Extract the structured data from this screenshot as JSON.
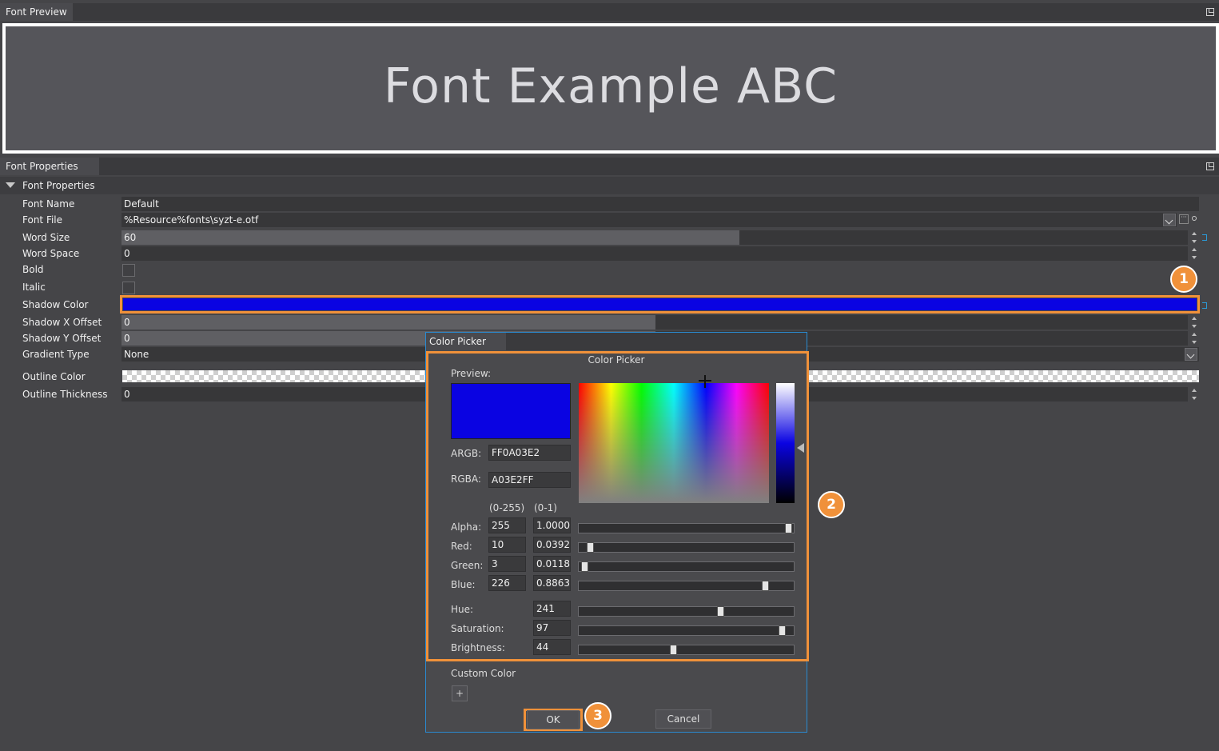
{
  "preview_panel": {
    "title": "Font Preview",
    "sample_text": "Font Example ABC"
  },
  "properties_panel": {
    "title": "Font Properties",
    "group_label": "Font Properties",
    "rows": {
      "font_name": {
        "label": "Font Name",
        "value": "Default"
      },
      "font_file": {
        "label": "Font File",
        "value": "%Resource%fonts\\syzt-e.otf"
      },
      "word_size": {
        "label": "Word Size",
        "value": "60",
        "fill_fraction": 0.5
      },
      "word_space": {
        "label": "Word Space",
        "value": "0"
      },
      "bold": {
        "label": "Bold",
        "checked": false
      },
      "italic": {
        "label": "Italic",
        "checked": false
      },
      "shadow_color": {
        "label": "Shadow Color",
        "color": "#0a03e2"
      },
      "shadow_x": {
        "label": "Shadow X Offset",
        "value": "0",
        "fill_fraction": 0.5
      },
      "shadow_y": {
        "label": "Shadow Y Offset",
        "value": "0",
        "fill_fraction": 0.5
      },
      "gradient_type": {
        "label": "Gradient Type",
        "value": "None"
      },
      "outline_color": {
        "label": "Outline Color",
        "color": "transparent"
      },
      "outline_thickness": {
        "label": "Outline Thickness",
        "value": "0"
      }
    }
  },
  "callouts": {
    "one": "1",
    "two": "2",
    "three": "3"
  },
  "accent_color": "#f0913a",
  "dialog": {
    "title": "Color Picker",
    "header": "Color Picker",
    "preview_label": "Preview:",
    "argb_label": "ARGB:",
    "argb_value": "FF0A03E2",
    "rgba_label": "RGBA:",
    "rgba_value": "A03E2FF",
    "range_255": "(0-255)",
    "range_01": "(0-1)",
    "channels": [
      {
        "label": "Alpha:",
        "v255": "255",
        "v01": "1.0000",
        "level": 1.0
      },
      {
        "label": "Red:",
        "v255": "10",
        "v01": "0.0392",
        "level": 0.039
      },
      {
        "label": "Green:",
        "v255": "3",
        "v01": "0.0118",
        "level": 0.012
      },
      {
        "label": "Blue:",
        "v255": "226",
        "v01": "0.8863",
        "level": 0.886
      }
    ],
    "hsb": [
      {
        "label": "Hue:",
        "value": "241",
        "level": 0.67
      },
      {
        "label": "Saturation:",
        "value": "97",
        "level": 0.97
      },
      {
        "label": "Brightness:",
        "value": "44",
        "level": 0.44
      }
    ],
    "custom_color_label": "Custom Color",
    "add_custom_glyph": "+",
    "ok_label": "OK",
    "cancel_label": "Cancel",
    "current_color": "#0a03e2"
  }
}
